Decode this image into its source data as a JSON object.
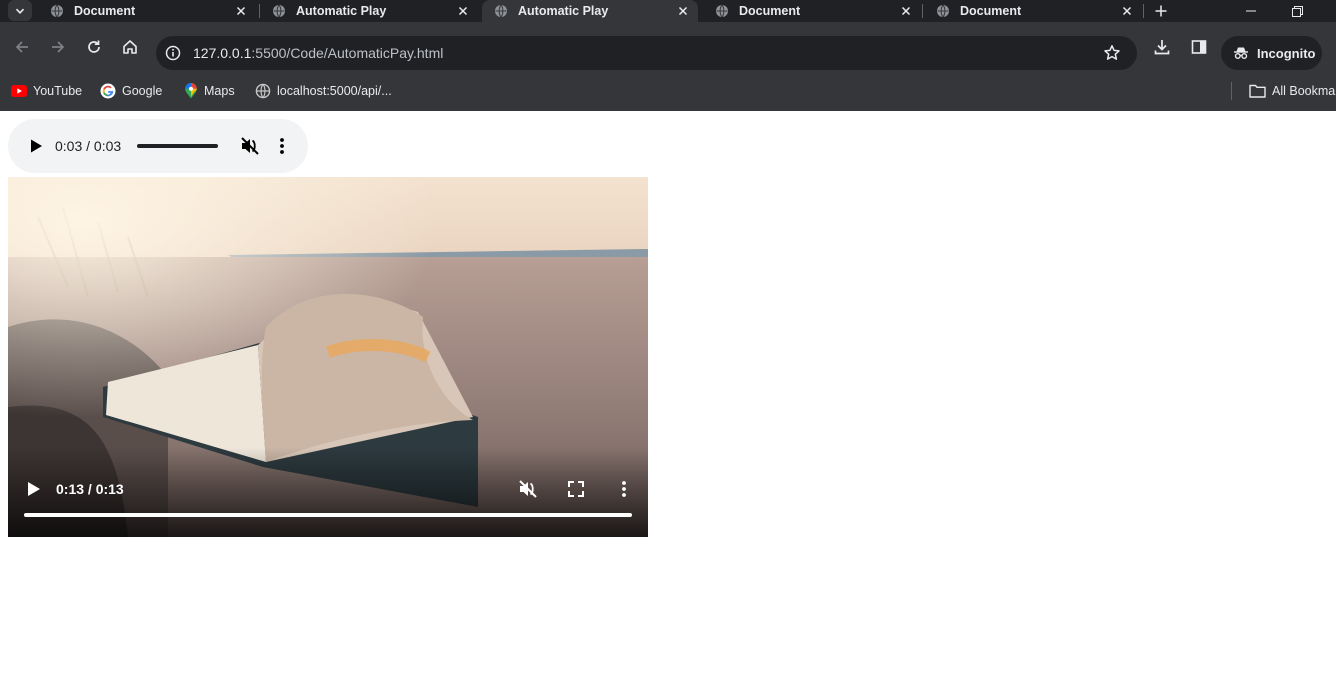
{
  "browser": {
    "tabs": [
      {
        "title": "Document",
        "active": false
      },
      {
        "title": "Automatic Play",
        "active": false
      },
      {
        "title": "Automatic Play",
        "active": true
      },
      {
        "title": "Document",
        "active": false
      },
      {
        "title": "Document",
        "active": false
      }
    ],
    "address": {
      "host": "127.0.0.1",
      "path": ":5500/Code/AutomaticPay.html"
    },
    "incognito_label": "Incognito",
    "bookmarks": [
      {
        "label": "YouTube",
        "icon": "youtube-icon"
      },
      {
        "label": "Google",
        "icon": "google-icon"
      },
      {
        "label": "Maps",
        "icon": "maps-icon"
      },
      {
        "label": "localhost:5000/api/...",
        "icon": "globe-icon"
      }
    ],
    "all_bookmarks_label": "All Bookma",
    "colors": {
      "tabstrip": "#202124",
      "toolbar": "#35363a",
      "omnibox": "#202124",
      "text": "#e8eaed"
    }
  },
  "audio_player": {
    "time": "0:03 / 0:03",
    "progress": 1.0,
    "muted": true,
    "colors": {
      "background": "#f1f3f4",
      "progress": "#202124"
    }
  },
  "video_player": {
    "time": "0:13 / 0:13",
    "progress": 1.0,
    "muted": true,
    "frame_description_icon": "video-frame-book-on-beach"
  }
}
